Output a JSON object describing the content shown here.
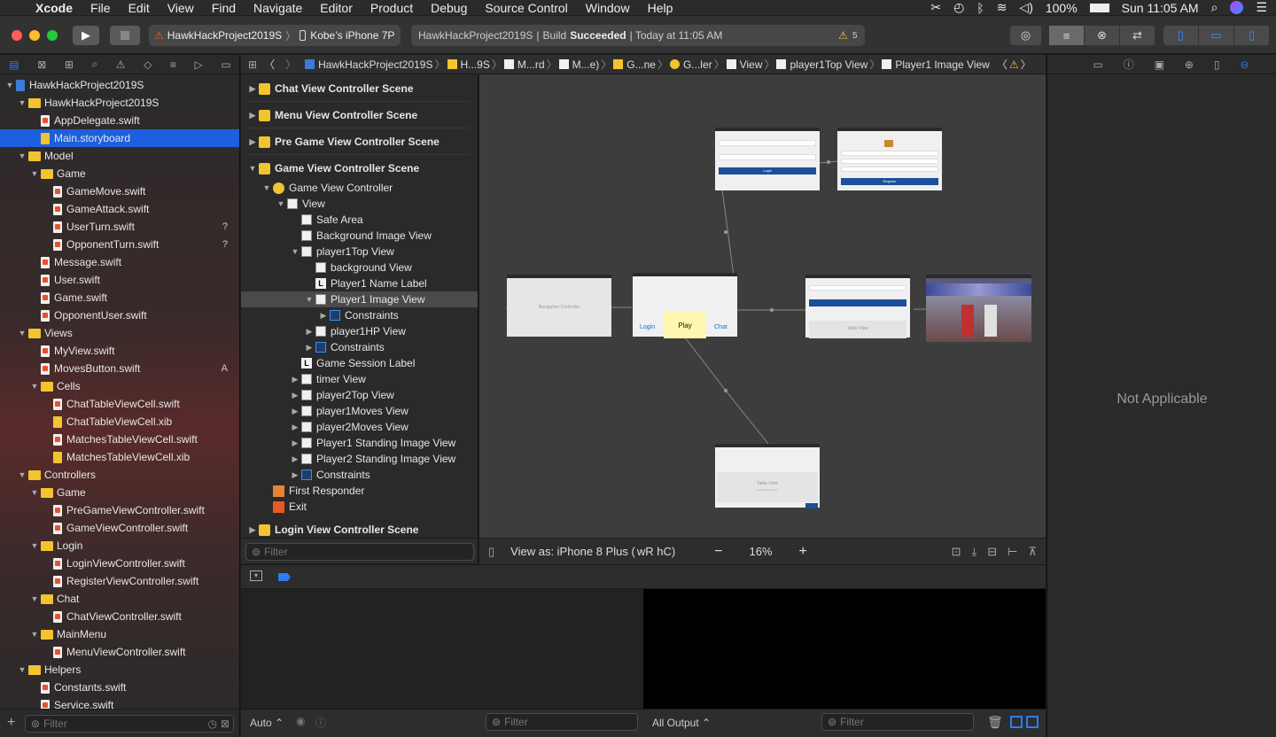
{
  "menubar": {
    "apple": "",
    "items": [
      "Xcode",
      "File",
      "Edit",
      "View",
      "Find",
      "Navigate",
      "Editor",
      "Product",
      "Debug",
      "Source Control",
      "Window",
      "Help"
    ],
    "battery": "100%",
    "clock": "Sun 11:05 AM"
  },
  "toolbar": {
    "scheme": "HawkHackProject2019S",
    "device": "Kobe’s iPhone 7P",
    "status_project": "HawkHackProject2019S",
    "status_sep": "|",
    "status_build": "Build",
    "status_result": "Succeeded",
    "status_time": "| Today at 11:05 AM",
    "warnings": "5"
  },
  "navigator": {
    "tabs": [
      "folder-icon",
      "x-box-icon",
      "hierarchy-icon",
      "magnify-icon",
      "warning-icon",
      "diamond-icon",
      "list-icon",
      "tag-icon",
      "chat-icon"
    ],
    "rows": [
      {
        "label": "HawkHackProject2019S",
        "indent": 0,
        "kind": "proj",
        "tri": "▼"
      },
      {
        "label": "HawkHackProject2019S",
        "indent": 1,
        "kind": "folder",
        "tri": "▼"
      },
      {
        "label": "AppDelegate.swift",
        "indent": 2,
        "kind": "swift",
        "tri": ""
      },
      {
        "label": "Main.storyboard",
        "indent": 2,
        "kind": "xib",
        "tri": "",
        "sel": true
      },
      {
        "label": "Model",
        "indent": 1,
        "kind": "folder",
        "tri": "▼"
      },
      {
        "label": "Game",
        "indent": 2,
        "kind": "folder",
        "tri": "▼"
      },
      {
        "label": "GameMove.swift",
        "indent": 3,
        "kind": "swift",
        "tri": ""
      },
      {
        "label": "GameAttack.swift",
        "indent": 3,
        "kind": "swift",
        "tri": ""
      },
      {
        "label": "UserTurn.swift",
        "indent": 3,
        "kind": "swift",
        "tri": "",
        "badge": "?"
      },
      {
        "label": "OpponentTurn.swift",
        "indent": 3,
        "kind": "swift",
        "tri": "",
        "badge": "?"
      },
      {
        "label": "Message.swift",
        "indent": 2,
        "kind": "swift",
        "tri": ""
      },
      {
        "label": "User.swift",
        "indent": 2,
        "kind": "swift",
        "tri": ""
      },
      {
        "label": "Game.swift",
        "indent": 2,
        "kind": "swift",
        "tri": ""
      },
      {
        "label": "OpponentUser.swift",
        "indent": 2,
        "kind": "swift",
        "tri": ""
      },
      {
        "label": "Views",
        "indent": 1,
        "kind": "folder",
        "tri": "▼"
      },
      {
        "label": "MyView.swift",
        "indent": 2,
        "kind": "swift",
        "tri": ""
      },
      {
        "label": "MovesButton.swift",
        "indent": 2,
        "kind": "swift",
        "tri": "",
        "badge": "A"
      },
      {
        "label": "Cells",
        "indent": 2,
        "kind": "folder",
        "tri": "▼"
      },
      {
        "label": "ChatTableViewCell.swift",
        "indent": 3,
        "kind": "swift",
        "tri": ""
      },
      {
        "label": "ChatTableViewCell.xib",
        "indent": 3,
        "kind": "xib",
        "tri": ""
      },
      {
        "label": "MatchesTableViewCell.swift",
        "indent": 3,
        "kind": "swift",
        "tri": ""
      },
      {
        "label": "MatchesTableViewCell.xib",
        "indent": 3,
        "kind": "xib",
        "tri": ""
      },
      {
        "label": "Controllers",
        "indent": 1,
        "kind": "folder",
        "tri": "▼"
      },
      {
        "label": "Game",
        "indent": 2,
        "kind": "folder",
        "tri": "▼"
      },
      {
        "label": "PreGameViewController.swift",
        "indent": 3,
        "kind": "swift",
        "tri": ""
      },
      {
        "label": "GameViewController.swift",
        "indent": 3,
        "kind": "swift",
        "tri": ""
      },
      {
        "label": "Login",
        "indent": 2,
        "kind": "folder",
        "tri": "▼"
      },
      {
        "label": "LoginViewController.swift",
        "indent": 3,
        "kind": "swift",
        "tri": ""
      },
      {
        "label": "RegisterViewController.swift",
        "indent": 3,
        "kind": "swift",
        "tri": ""
      },
      {
        "label": "Chat",
        "indent": 2,
        "kind": "folder",
        "tri": "▼"
      },
      {
        "label": "ChatViewController.swift",
        "indent": 3,
        "kind": "swift",
        "tri": ""
      },
      {
        "label": "MainMenu",
        "indent": 2,
        "kind": "folder",
        "tri": "▼"
      },
      {
        "label": "MenuViewController.swift",
        "indent": 3,
        "kind": "swift",
        "tri": ""
      },
      {
        "label": "Helpers",
        "indent": 1,
        "kind": "folder",
        "tri": "▼"
      },
      {
        "label": "Constants.swift",
        "indent": 2,
        "kind": "swift",
        "tri": ""
      },
      {
        "label": "Service.swift",
        "indent": 2,
        "kind": "swift",
        "tri": ""
      }
    ],
    "filter_placeholder": "Filter"
  },
  "jumpbar": [
    "HawkHackProject2019S",
    "H...9S",
    "M...rd",
    "M...e)",
    "G...ne",
    "G...ler",
    "View",
    "player1Top View",
    "Player1 Image View"
  ],
  "outline": {
    "rows": [
      {
        "label": "Chat View Controller Scene",
        "level": 0,
        "icon": "scene",
        "tri": "▶",
        "bold": true
      },
      {
        "label": "Menu View Controller Scene",
        "level": 0,
        "icon": "scene",
        "tri": "▶",
        "bold": true
      },
      {
        "label": "Pre Game View Controller Scene",
        "level": 0,
        "icon": "scene",
        "tri": "▶",
        "bold": true
      },
      {
        "label": "Game View Controller Scene",
        "level": 0,
        "icon": "scene",
        "tri": "▼",
        "bold": true
      },
      {
        "label": "Game View Controller",
        "level": 1,
        "icon": "vc",
        "tri": "▼"
      },
      {
        "label": "View",
        "level": 2,
        "icon": "view",
        "tri": "▼"
      },
      {
        "label": "Safe Area",
        "level": 3,
        "icon": "view",
        "tri": ""
      },
      {
        "label": "Background Image View",
        "level": 3,
        "icon": "view",
        "tri": ""
      },
      {
        "label": "player1Top View",
        "level": 3,
        "icon": "view",
        "tri": "▼"
      },
      {
        "label": "background View",
        "level": 4,
        "icon": "view",
        "tri": ""
      },
      {
        "label": "Player1 Name Label",
        "level": 4,
        "icon": "label",
        "tri": ""
      },
      {
        "label": "Player1 Image View",
        "level": 4,
        "icon": "view",
        "tri": "▼",
        "hl": true
      },
      {
        "label": "Constraints",
        "level": 5,
        "icon": "cons",
        "tri": "▶"
      },
      {
        "label": "player1HP View",
        "level": 4,
        "icon": "view",
        "tri": "▶"
      },
      {
        "label": "Constraints",
        "level": 4,
        "icon": "cons",
        "tri": "▶"
      },
      {
        "label": "Game Session Label",
        "level": 3,
        "icon": "label",
        "tri": ""
      },
      {
        "label": "timer View",
        "level": 3,
        "icon": "view",
        "tri": "▶"
      },
      {
        "label": "player2Top View",
        "level": 3,
        "icon": "view",
        "tri": "▶"
      },
      {
        "label": "player1Moves View",
        "level": 3,
        "icon": "view",
        "tri": "▶"
      },
      {
        "label": "player2Moves View",
        "level": 3,
        "icon": "view",
        "tri": "▶"
      },
      {
        "label": "Player1 Standing Image View",
        "level": 3,
        "icon": "view",
        "tri": "▶"
      },
      {
        "label": "Player2 Standing Image View",
        "level": 3,
        "icon": "view",
        "tri": "▶"
      },
      {
        "label": "Constraints",
        "level": 3,
        "icon": "cons",
        "tri": "▶"
      },
      {
        "label": "First Responder",
        "level": 1,
        "icon": "fr",
        "tri": ""
      },
      {
        "label": "Exit",
        "level": 1,
        "icon": "exit",
        "tri": ""
      },
      {
        "label": "Login View Controller Scene",
        "level": 0,
        "icon": "scene",
        "tri": "▶",
        "bold": true
      }
    ],
    "filter_placeholder": "Filter"
  },
  "canvas": {
    "nav_controller": "Navigation Controller",
    "play_button": "Play",
    "login_link": "Login",
    "chat_link": "Chat",
    "table_view": "Table View",
    "prototype": "Prototype Content",
    "login_btn": "Login",
    "register_btn": "Register",
    "view_as": "View as: iPhone 8 Plus (",
    "size_class": "wR hC)",
    "zoom": "16%"
  },
  "debug": {
    "auto_label": "Auto ⌃",
    "filter_placeholder": "Filter",
    "output_label": "All Output ⌃",
    "filter2_placeholder": "Filter"
  },
  "inspector": {
    "not_applicable": "Not Applicable"
  }
}
